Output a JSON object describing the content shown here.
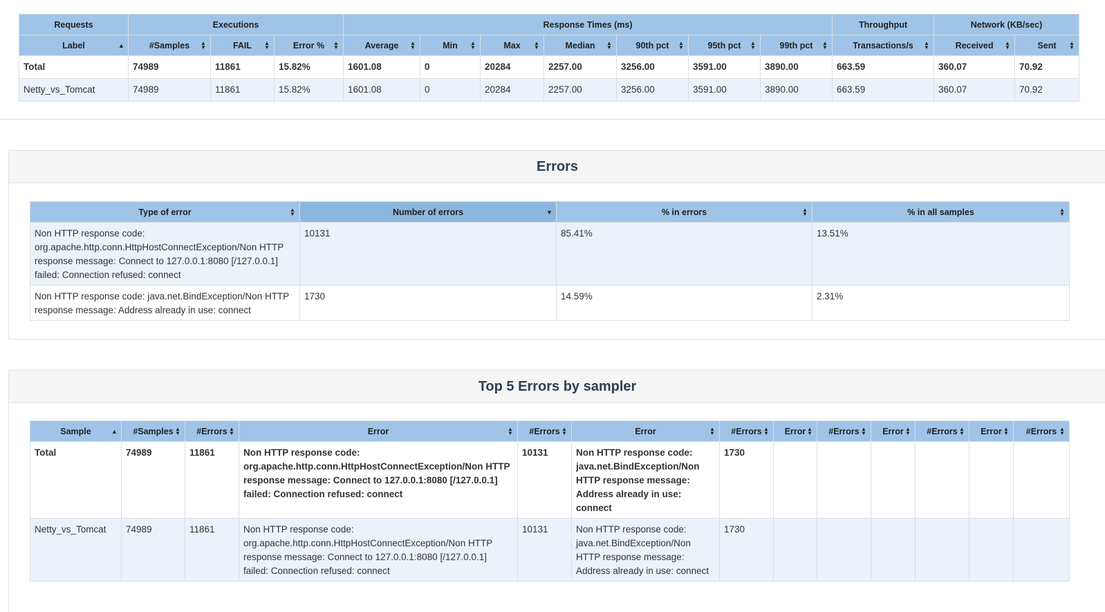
{
  "statistics": {
    "group_headers": [
      "Requests",
      "Executions",
      "Response Times (ms)",
      "Throughput",
      "Network (KB/sec)"
    ],
    "columns": [
      "Label",
      "#Samples",
      "FAIL",
      "Error %",
      "Average",
      "Min",
      "Max",
      "Median",
      "90th pct",
      "95th pct",
      "99th pct",
      "Transactions/s",
      "Received",
      "Sent"
    ],
    "total_row": [
      "Total",
      "74989",
      "11861",
      "15.82%",
      "1601.08",
      "0",
      "20284",
      "2257.00",
      "3256.00",
      "3591.00",
      "3890.00",
      "663.59",
      "360.07",
      "70.92"
    ],
    "rows": [
      [
        "Netty_vs_Tomcat",
        "74989",
        "11861",
        "15.82%",
        "1601.08",
        "0",
        "20284",
        "2257.00",
        "3256.00",
        "3591.00",
        "3890.00",
        "663.59",
        "360.07",
        "70.92"
      ]
    ]
  },
  "errors": {
    "title": "Errors",
    "columns": [
      "Type of error",
      "Number of errors",
      "% in errors",
      "% in all samples"
    ],
    "rows": [
      [
        "Non HTTP response code: org.apache.http.conn.HttpHostConnectException/Non HTTP response message: Connect to 127.0.0.1:8080 [/127.0.0.1] failed: Connection refused: connect",
        "10131",
        "85.41%",
        "13.51%"
      ],
      [
        "Non HTTP response code: java.net.BindException/Non HTTP response message: Address already in use: connect",
        "1730",
        "14.59%",
        "2.31%"
      ]
    ]
  },
  "top5": {
    "title": "Top 5 Errors by sampler",
    "columns": [
      "Sample",
      "#Samples",
      "#Errors",
      "Error",
      "#Errors",
      "Error",
      "#Errors",
      "Error",
      "#Errors",
      "Error",
      "#Errors",
      "Error",
      "#Errors"
    ],
    "total_row": [
      "Total",
      "74989",
      "11861",
      "Non HTTP response code: org.apache.http.conn.HttpHostConnectException/Non HTTP response message: Connect to 127.0.0.1:8080 [/127.0.0.1] failed: Connection refused: connect",
      "10131",
      "Non HTTP response code: java.net.BindException/Non HTTP response message: Address already in use: connect",
      "1730",
      "",
      "",
      "",
      "",
      "",
      ""
    ],
    "rows": [
      [
        "Netty_vs_Tomcat",
        "74989",
        "11861",
        "Non HTTP response code: org.apache.http.conn.HttpHostConnectException/Non HTTP response message: Connect to 127.0.0.1:8080 [/127.0.0.1] failed: Connection refused: connect",
        "10131",
        "Non HTTP response code: java.net.BindException/Non HTTP response message: Address already in use: connect",
        "1730",
        "",
        "",
        "",
        "",
        "",
        ""
      ]
    ]
  },
  "sort_icons": {
    "both": "sort-both-icon",
    "asc": "sort-asc-icon",
    "desc": "sort-desc-icon"
  }
}
